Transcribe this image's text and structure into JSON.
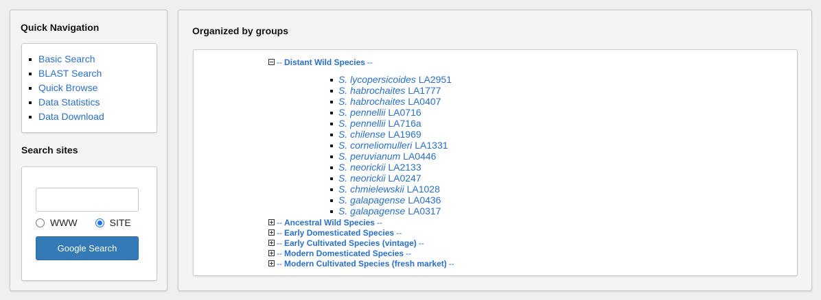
{
  "left": {
    "quick_nav_title": "Quick Navigation",
    "nav_items": [
      "Basic Search",
      "BLAST Search",
      "Quick Browse",
      "Data Statistics",
      "Data Download"
    ],
    "search_title": "Search sites",
    "search": {
      "value": "",
      "radio_www": "WWW",
      "radio_site": "SITE",
      "selected": "SITE",
      "button": "Google Search"
    }
  },
  "main": {
    "title": "Organized by groups",
    "dash": "--",
    "expanded_group": {
      "name": "Distant Wild Species",
      "species": [
        {
          "name": "S. lycopersicoides",
          "id": "LA2951"
        },
        {
          "name": "S. habrochaites",
          "id": "LA1777"
        },
        {
          "name": "S. habrochaites",
          "id": "LA0407"
        },
        {
          "name": "S. pennellii",
          "id": "LA0716"
        },
        {
          "name": "S. pennellii",
          "id": "LA716a"
        },
        {
          "name": "S. chilense",
          "id": "LA1969"
        },
        {
          "name": "S. corneliomulleri",
          "id": "LA1331"
        },
        {
          "name": "S. peruvianum",
          "id": "LA0446"
        },
        {
          "name": "S. neorickii",
          "id": "LA2133"
        },
        {
          "name": "S. neorickii",
          "id": "LA0247"
        },
        {
          "name": "S. chmielewskii",
          "id": "LA1028"
        },
        {
          "name": "S. galapagense",
          "id": "LA0436"
        },
        {
          "name": "S. galapagense",
          "id": "LA0317"
        }
      ]
    },
    "collapsed_groups": [
      "Ancestral Wild Species",
      "Early Domesticated Species",
      "Early Cultivated Species (vintage)",
      "Modern Domesticated Species",
      "Modern Cultivated Species (fresh market)"
    ]
  }
}
